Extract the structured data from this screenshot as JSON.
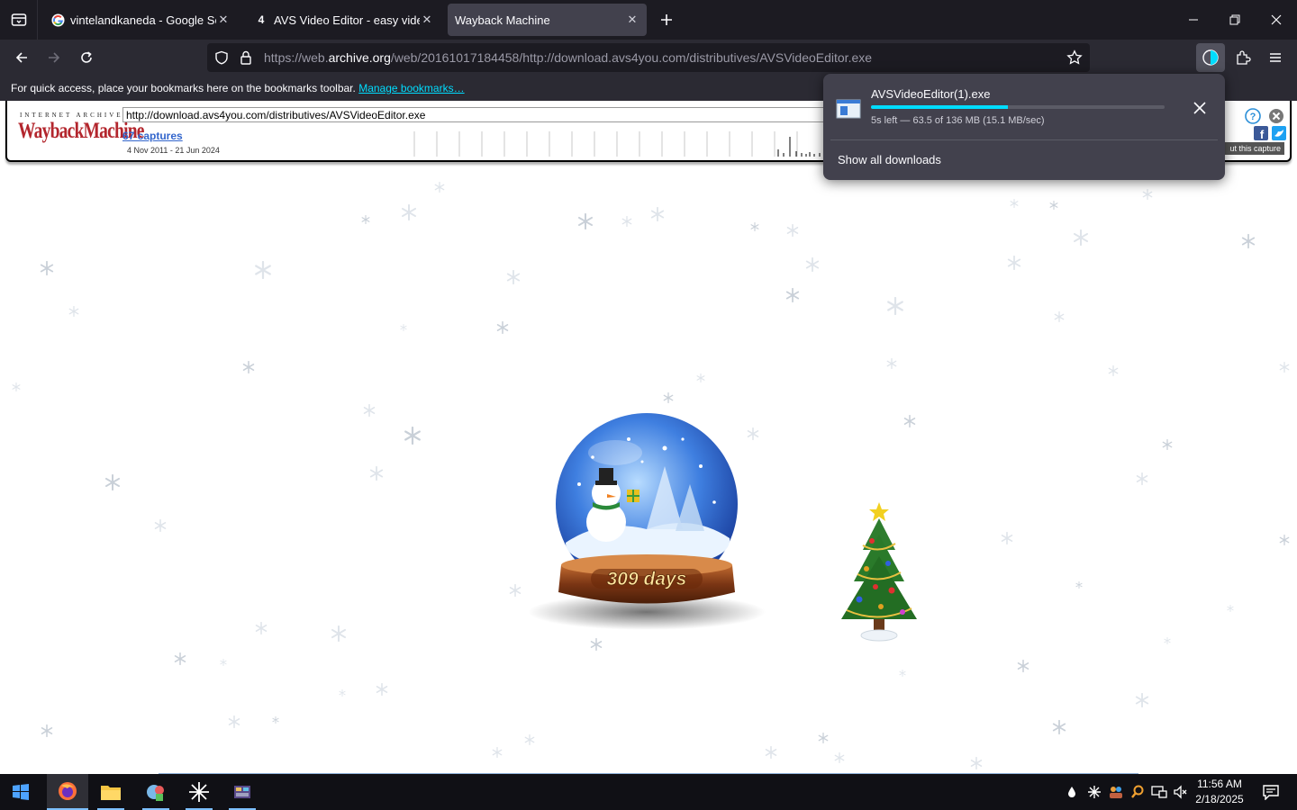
{
  "tabs": [
    {
      "title": "vintelandkaneda - Google Search",
      "favicon": "google-icon"
    },
    {
      "title": "AVS Video Editor - easy video editing",
      "favicon": "avs-icon",
      "badge": "4"
    },
    {
      "title": "Wayback Machine",
      "favicon": "none",
      "active": true
    }
  ],
  "nav": {
    "url_prefix": "https://web.",
    "url_host": "archive.org",
    "url_rest": "/web/20161017184458/http://download.avs4you.com/distributives/AVSVideoEditor.exe"
  },
  "bookmarks": {
    "text": "For quick access, place your bookmarks here on the bookmarks toolbar.",
    "link": "Manage bookmarks…"
  },
  "wayback": {
    "logo_top": "INTERNET ARCHIVE",
    "logo_main": "WaybackMachine",
    "url_value": "http://download.avs4you.com/distributives/AVSVideoEditor.exe",
    "captures": "67 captures",
    "range": "4 Nov 2011 - 21 Jun 2024",
    "about": "ut this capture"
  },
  "download": {
    "filename": "AVSVideoEditor(1).exe",
    "status": "5s left — 63.5 of 136 MB (15.1 MB/sec)",
    "progress": 0.467,
    "show_all": "Show all downloads"
  },
  "scene": {
    "countdown": "309 days"
  },
  "taskbar": {
    "time": "11:56 AM",
    "date": "2/18/2025"
  },
  "colors": {
    "accent": "#00ddff",
    "wayback_red": "#b3262d",
    "chrome_dark": "#1c1b22"
  }
}
